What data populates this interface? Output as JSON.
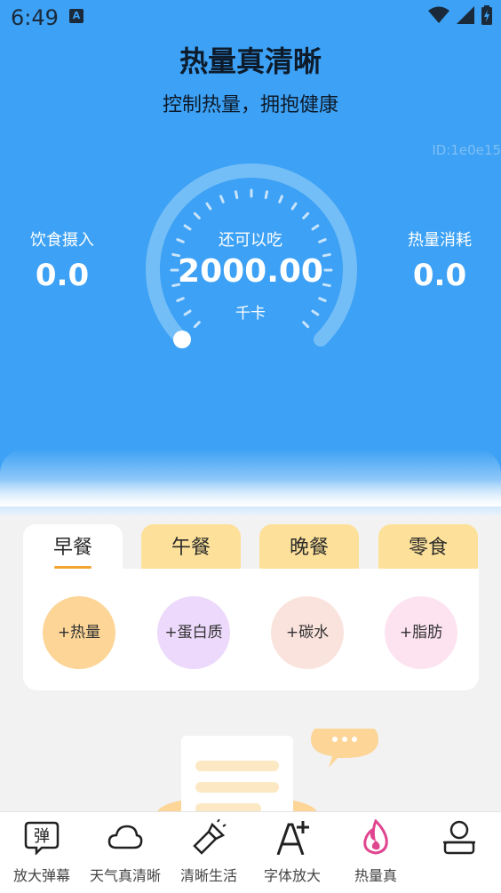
{
  "status_bar": {
    "time": "6:49",
    "notif_icon": "A"
  },
  "header": {
    "title": "热量真清晰",
    "subtitle": "控制热量，拥抱健康",
    "ghost_text": "ID:1e0e15"
  },
  "summary": {
    "intake_label": "饮食摄入",
    "intake_value": "0.0",
    "burn_label": "热量消耗",
    "burn_value": "0.0",
    "remain_label": "还可以吃",
    "remain_value": "2000.00",
    "unit": "千卡",
    "progress_fraction": 0
  },
  "meal_tabs": [
    {
      "label": "早餐",
      "active": true
    },
    {
      "label": "午餐",
      "active": false
    },
    {
      "label": "晚餐",
      "active": false
    },
    {
      "label": "零食",
      "active": false
    }
  ],
  "add_buttons": [
    {
      "label": "+热量",
      "color": "#fcd597"
    },
    {
      "label": "+蛋白质",
      "color": "#ecd9fb"
    },
    {
      "label": "+碳水",
      "color": "#fbe3dd"
    },
    {
      "label": "+脂肪",
      "color": "#fde3f0"
    }
  ],
  "bottom_nav": [
    {
      "label": "放大弹幕",
      "icon": "danmu-icon",
      "glyph": "弹"
    },
    {
      "label": "天气真清晰",
      "icon": "cloud-icon"
    },
    {
      "label": "清晰生活",
      "icon": "flashlight-icon"
    },
    {
      "label": "字体放大",
      "icon": "font-plus-icon"
    },
    {
      "label": "热量真",
      "icon": "flame-icon",
      "active": true
    },
    {
      "label": "",
      "icon": "profile-icon"
    }
  ],
  "colors": {
    "primary": "#3da1f5",
    "tab_inactive": "#fde19a",
    "accent": "#f2a530",
    "nav_active": "#e0458f"
  }
}
